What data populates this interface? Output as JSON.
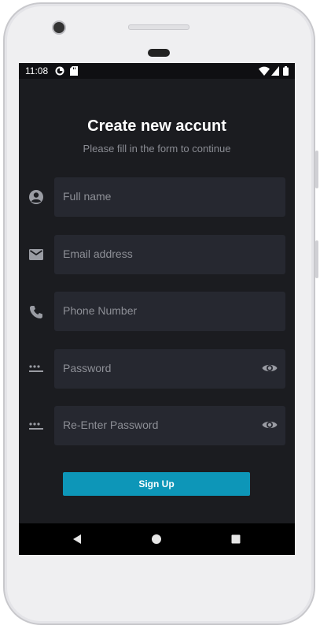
{
  "status_bar": {
    "time": "11:08",
    "icons": [
      "app-notification-icon",
      "sd-card-icon",
      "wifi-icon",
      "signal-icon",
      "battery-icon"
    ]
  },
  "header": {
    "title": "Create new accunt",
    "subtitle": "Please fill in the form to continue"
  },
  "form": {
    "fields": [
      {
        "icon": "person-icon",
        "placeholder": "Full name",
        "toggle": false
      },
      {
        "icon": "mail-icon",
        "placeholder": "Email address",
        "toggle": false
      },
      {
        "icon": "phone-icon",
        "placeholder": "Phone Number",
        "toggle": false
      },
      {
        "icon": "password-dots-icon",
        "placeholder": "Password",
        "toggle": true
      },
      {
        "icon": "password-dots-icon",
        "placeholder": "Re-Enter Password",
        "toggle": true
      }
    ],
    "submit_label": "Sign Up"
  },
  "nav_bar": {
    "buttons": [
      "back-icon",
      "home-icon",
      "recents-icon"
    ]
  },
  "colors": {
    "background": "#1b1c20",
    "field_background": "#262830",
    "accent": "#0d96b8",
    "placeholder": "#8d8f96",
    "icon": "#9a9ca3"
  }
}
